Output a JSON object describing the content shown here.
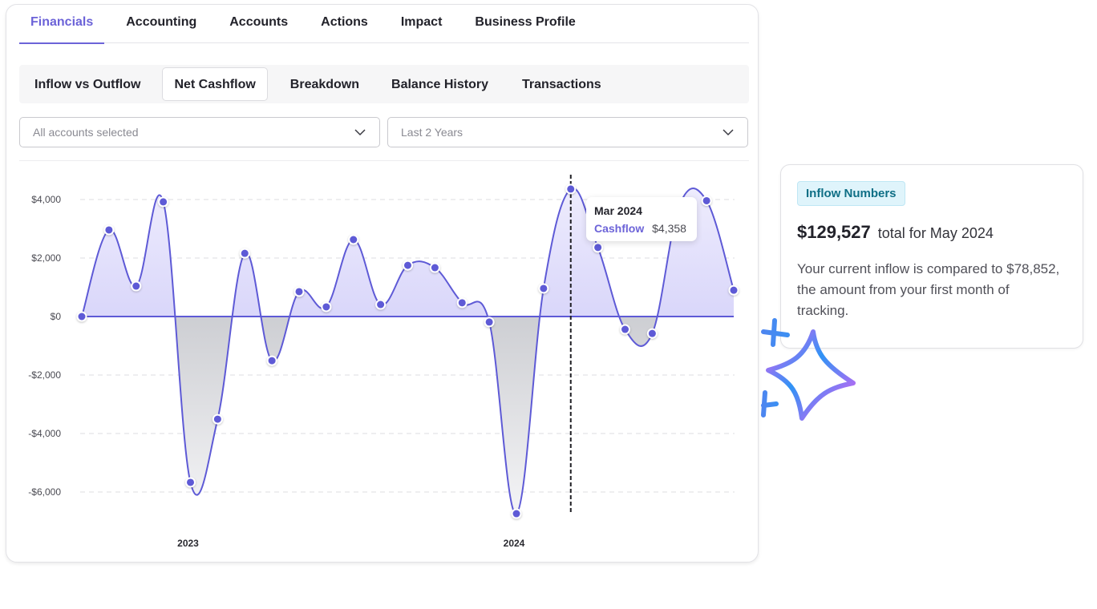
{
  "top_tabs": [
    {
      "label": "Financials",
      "active": true
    },
    {
      "label": "Accounting",
      "active": false
    },
    {
      "label": "Accounts",
      "active": false
    },
    {
      "label": "Actions",
      "active": false
    },
    {
      "label": "Impact",
      "active": false
    },
    {
      "label": "Business Profile",
      "active": false
    }
  ],
  "sub_tabs": [
    {
      "label": "Inflow vs Outflow",
      "active": false
    },
    {
      "label": "Net Cashflow",
      "active": true
    },
    {
      "label": "Breakdown",
      "active": false
    },
    {
      "label": "Balance History",
      "active": false
    },
    {
      "label": "Transactions",
      "active": false
    }
  ],
  "filters": {
    "accounts": {
      "value": "All accounts selected",
      "icon": "chevron-down-icon"
    },
    "period": {
      "value": "Last 2 Years",
      "icon": "chevron-down-icon"
    }
  },
  "tooltip": {
    "date": "Mar 2024",
    "series_label": "Cashflow",
    "value": "$4,358"
  },
  "info_card": {
    "badge": "Inflow Numbers",
    "amount": "$129,527",
    "amount_suffix": "total for May 2024",
    "description": "Your current inflow is compared to $78,852, the amount from your first month of tracking."
  },
  "colors": {
    "accent": "#6c63d8",
    "line": "#5e5ad6",
    "positive_fill": "#b9b5f5",
    "negative_fill": "#b4b6bc",
    "badge_bg": "#dff4fb",
    "badge_text": "#0f6f86"
  },
  "chart_data": {
    "type": "area",
    "title": "Net Cashflow",
    "xlabel": "",
    "ylabel": "",
    "series": [
      {
        "name": "Cashflow",
        "values": [
          0,
          2960,
          1040,
          3920,
          -5670,
          -3510,
          2160,
          -1510,
          850,
          330,
          2630,
          410,
          1750,
          1670,
          470,
          -190,
          -6740,
          960,
          4358,
          2360,
          -440,
          -580,
          3800,
          3960,
          900
        ]
      }
    ],
    "x_tick_labels": [
      {
        "label": "2023",
        "index": 4
      },
      {
        "label": "2024",
        "index": 16
      }
    ],
    "y_ticks": [
      4000,
      2000,
      0,
      -2000,
      -4000,
      -6000
    ],
    "y_tick_labels": [
      "$4,000",
      "$2,000",
      "$0",
      "-$2,000",
      "-$4,000",
      "-$6,000"
    ],
    "ylim": [
      -7500,
      5200
    ],
    "grid": true,
    "highlight_index": 18,
    "legend": "none"
  }
}
